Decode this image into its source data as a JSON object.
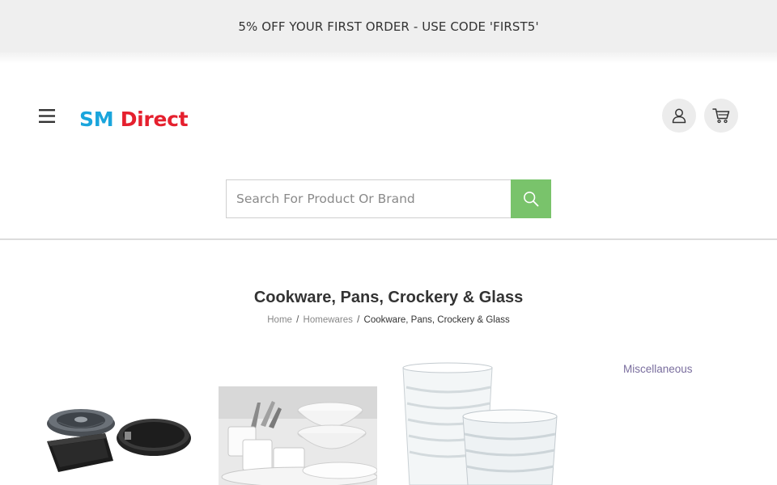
{
  "promo": {
    "text": "5% OFF YOUR FIRST ORDER - USE CODE 'FIRST5'"
  },
  "header": {
    "menu_icon": "hamburger-icon",
    "logo": {
      "part1": "SM",
      "part2": "Direct",
      "color1": "#1aa5dc",
      "color2": "#e5202e"
    },
    "account_icon": "user-icon",
    "cart_icon": "cart-icon"
  },
  "search": {
    "placeholder": "Search For Product Or Brand",
    "value": "",
    "button_icon": "search-icon",
    "button_color": "#79c36b"
  },
  "page": {
    "title": "Cookware, Pans, Crockery & Glass",
    "breadcrumb": {
      "home": "Home",
      "sep1": "/",
      "section": "Homewares",
      "sep2": "/",
      "current": "Cookware, Pans, Crockery & Glass"
    }
  },
  "categories": {
    "items": [
      {
        "image": "bakeware-pans"
      },
      {
        "image": "white-crockery"
      },
      {
        "image": "glass-tumblers"
      },
      {
        "label": "Miscellaneous"
      }
    ]
  }
}
